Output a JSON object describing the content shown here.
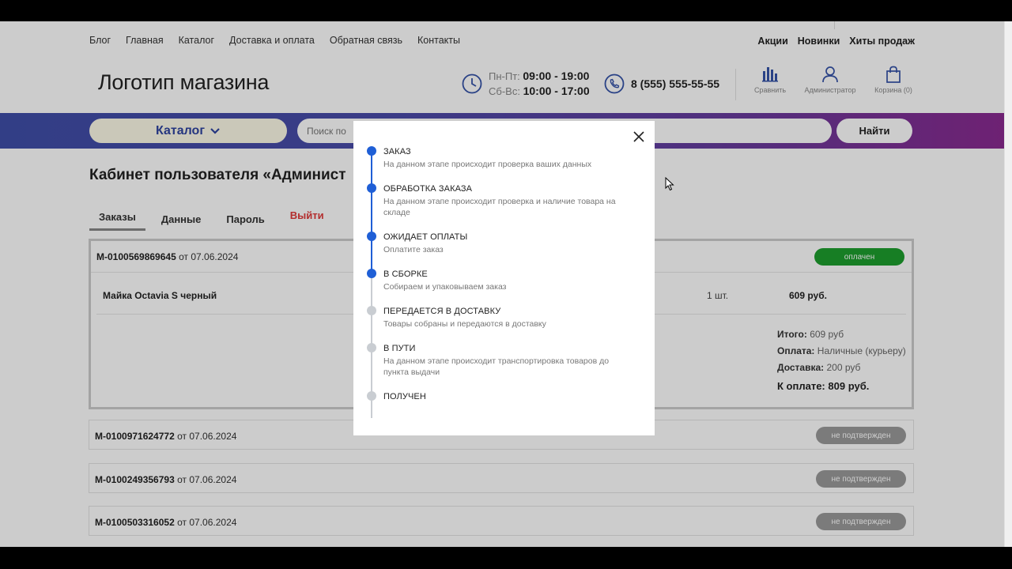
{
  "topnav": {
    "left": [
      "Блог",
      "Главная",
      "Каталог",
      "Доставка и оплата",
      "Обратная связь",
      "Контакты"
    ],
    "right": [
      "Акции",
      "Новинки",
      "Хиты продаж"
    ]
  },
  "header": {
    "logo": "Логотип магазина",
    "hours": {
      "weekday_label": "Пн-Пт:",
      "weekday_time": "09:00 - 19:00",
      "weekend_label": "Сб-Вс:",
      "weekend_time": "10:00 - 17:00"
    },
    "phone": "8 (555) 555-55-55",
    "icons": [
      {
        "label": "Сравнить",
        "icon": "compare-chart-icon"
      },
      {
        "label": "Администратор",
        "icon": "user-icon"
      },
      {
        "label": "Корзина (0)",
        "icon": "cart-bag-icon"
      }
    ]
  },
  "search": {
    "catalog_label": "Каталог",
    "placeholder": "Поиск по",
    "find_label": "Найти"
  },
  "page": {
    "title": "Кабинет пользователя «Админист",
    "tabs": [
      "Заказы",
      "Данные",
      "Пароль",
      "Выйти"
    ]
  },
  "orders": [
    {
      "number": "M-0100569869645",
      "date_prefix": "от",
      "date": "07.06.2024",
      "status": "оплачен",
      "item": {
        "name": "Майка Octavia S черный",
        "qty": "1 шт.",
        "price": "609 руб."
      },
      "totals": {
        "total_label": "Итого:",
        "total_value": "609 руб",
        "payment_label": "Оплата:",
        "payment_value": "Наличные (курьеру)",
        "delivery_label": "Доставка:",
        "delivery_value": "200 руб",
        "pay_label": "К оплате:",
        "pay_value": "809 руб."
      }
    },
    {
      "number": "M-0100971624772",
      "date_prefix": "от",
      "date": "07.06.2024",
      "status": "не подтвержден"
    },
    {
      "number": "M-0100249356793",
      "date_prefix": "от",
      "date": "07.06.2024",
      "status": "не подтвержден"
    },
    {
      "number": "M-0100503316052",
      "date_prefix": "от",
      "date": "07.06.2024",
      "status": "не подтвержден"
    }
  ],
  "modal": {
    "steps": [
      {
        "title": "ЗАКАЗ",
        "desc": "На данном этапе происходит проверка ваших данных",
        "active": true
      },
      {
        "title": "ОБРАБОТКА ЗАКАЗА",
        "desc": "На данном этапе происходит проверка и наличие товара на складе",
        "active": true
      },
      {
        "title": "ОЖИДАЕТ ОПЛАТЫ",
        "desc": "Оплатите заказ",
        "active": true
      },
      {
        "title": "В СБОРКЕ",
        "desc": "Собираем и упаковываем заказ",
        "active": true
      },
      {
        "title": "ПЕРЕДАЕТСЯ В ДОСТАВКУ",
        "desc": "Товары собраны и передаются в доставку",
        "active": false
      },
      {
        "title": "В ПУТИ",
        "desc": "На данном этапе происходит транспортировка товаров до пункта выдачи",
        "active": false
      },
      {
        "title": "ПОЛУЧЕН",
        "desc": "",
        "active": false
      }
    ]
  },
  "colors": {
    "accent_blue": "#1f5fd6",
    "status_paid": "#1d9e2d",
    "status_unconfirmed": "#9a9a9a",
    "logout": "#e03a3a"
  }
}
